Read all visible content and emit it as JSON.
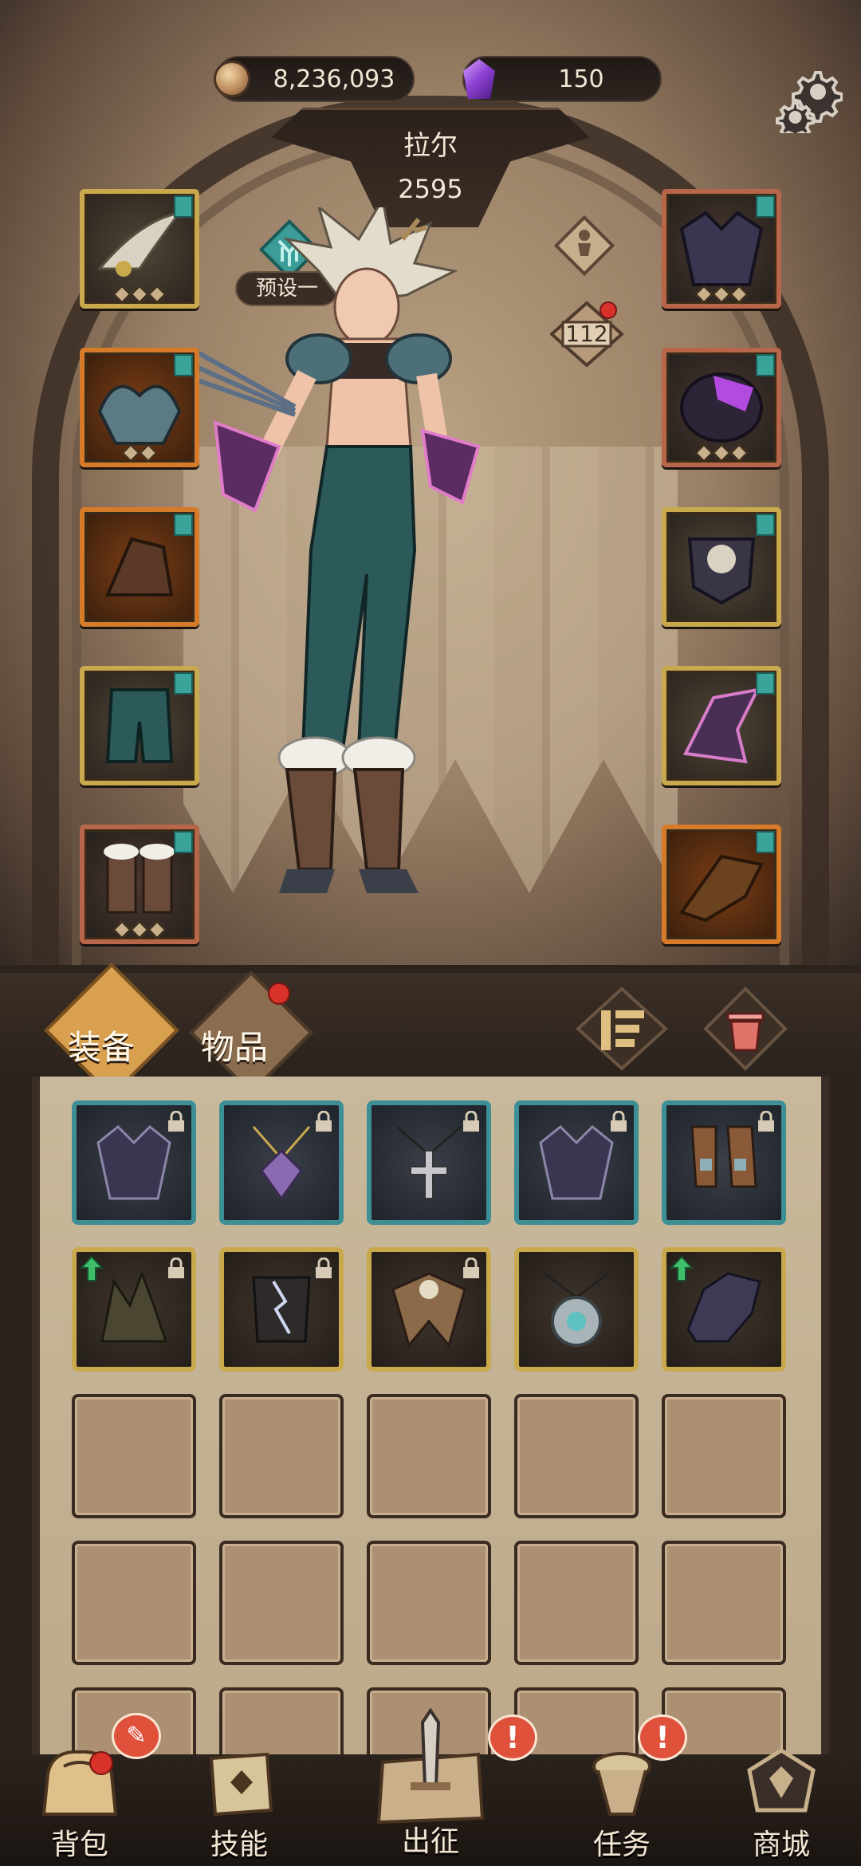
{
  "currency": {
    "coins": "8,236,093",
    "gems": "150",
    "coin_icon": "coin-icon",
    "gem_icon": "purple-crystal-icon"
  },
  "hero": {
    "name": "拉尔",
    "power": "2595",
    "level": "112",
    "preset_label": "预设一"
  },
  "equipment_slots": {
    "left": [
      "wing-crown",
      "shoulder-armor",
      "gauntlet",
      "leg-armor",
      "boots"
    ],
    "right": [
      "dark-armor",
      "purple-stone",
      "skull-shield",
      "thorn-bracer",
      "wood-claw"
    ]
  },
  "tabs": {
    "equipment": "装备",
    "items": "物品"
  },
  "inventory": {
    "items": [
      {
        "icon": "dark-armor-icon",
        "rarity": "teal",
        "locked": true
      },
      {
        "icon": "amulet-icon",
        "rarity": "teal",
        "locked": true
      },
      {
        "icon": "cross-necklace-icon",
        "rarity": "teal",
        "locked": true
      },
      {
        "icon": "dark-armor-icon",
        "rarity": "teal",
        "locked": true
      },
      {
        "icon": "leather-boots-icon",
        "rarity": "teal",
        "locked": true
      },
      {
        "icon": "spiked-gauntlet-icon",
        "rarity": "gold",
        "locked": true,
        "upgrade": true
      },
      {
        "icon": "lightning-bracer-icon",
        "rarity": "gold",
        "locked": true
      },
      {
        "icon": "bone-armor-icon",
        "rarity": "gold",
        "locked": true
      },
      {
        "icon": "medallion-icon",
        "rarity": "gold",
        "locked": false
      },
      {
        "icon": "dragon-helm-icon",
        "rarity": "gold",
        "locked": false,
        "upgrade": true
      }
    ],
    "empty_slots": 15
  },
  "nav": {
    "bag": "背包",
    "skills": "技能",
    "expedition": "出征",
    "quests": "任务",
    "shop": "商城"
  },
  "colors": {
    "accent_gold": "#c9a94e",
    "rarity_teal": "#3e8f95",
    "alert_red": "#e0513c",
    "upgrade_green": "#3fbf6a"
  }
}
